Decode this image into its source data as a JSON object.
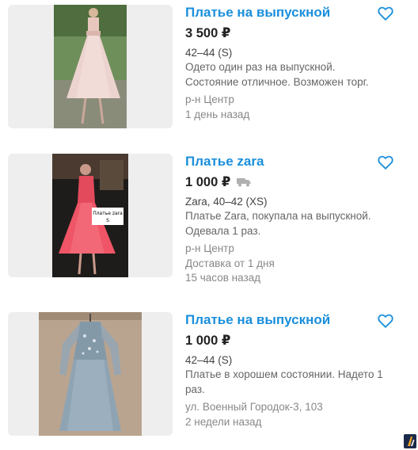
{
  "listings": [
    {
      "title": "Платье на выпускной",
      "price": "3 500 ₽",
      "size": "42–44 (S)",
      "description_lines": [
        "Одето один раз на выпускной.",
        "Состояние отличное. Возможен торг."
      ],
      "location": "р-н Центр",
      "delivery": "",
      "time": "1 день назад",
      "favorite_icon": "heart-outline-icon"
    },
    {
      "title": "Платье zara",
      "price": "1 000 ₽",
      "size": "Zara, 40–42 (XS)",
      "description_lines": [
        "Платье Zara, покупала на выпускной.",
        "Одевала 1 раз."
      ],
      "location": "р-н Центр",
      "delivery": "Доставка от 1 дня",
      "time": "15 часов назад",
      "favorite_icon": "heart-outline-icon",
      "delivery_icon": "truck-icon",
      "photo_caption": "Платье zara S"
    },
    {
      "title": "Платье на выпускной",
      "price": "1 000 ₽",
      "size": "42–44 (S)",
      "description_lines": [
        "Платье в хорошем состоянии. Надето 1",
        "раз."
      ],
      "location": "ул. Военный Городок-3, 103",
      "delivery": "",
      "time": "2 недели назад",
      "favorite_icon": "heart-outline-icon"
    }
  ],
  "colors": {
    "title_link": "#1a8fdc",
    "price": "#222222",
    "thumbnail_bg": "#eeeeee"
  }
}
